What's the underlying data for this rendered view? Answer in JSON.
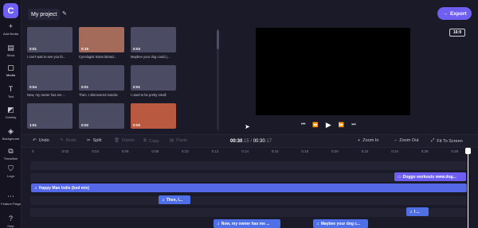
{
  "app": {
    "logo": "C"
  },
  "rail": [
    {
      "icon": "plus-icon",
      "glyph": "+",
      "label": "Add Media"
    },
    {
      "icon": "stock-icon",
      "glyph": "▤",
      "label": "Stock"
    },
    {
      "icon": "media-icon",
      "glyph": "▢",
      "label": "Media"
    },
    {
      "icon": "text-icon",
      "glyph": "T",
      "label": "Text"
    },
    {
      "icon": "overlay-icon",
      "glyph": "◩",
      "label": "Overlay"
    },
    {
      "icon": "background-icon",
      "glyph": "◈",
      "label": "Background"
    },
    {
      "icon": "transition-icon",
      "glyph": "⧉",
      "label": "Transition"
    },
    {
      "icon": "logo-icon",
      "glyph": "⛉",
      "label": "Logo"
    },
    {
      "icon": "feature-flags-icon",
      "glyph": "⋯",
      "label": "Feature Flags"
    },
    {
      "icon": "help-icon",
      "glyph": "?",
      "label": "Help"
    }
  ],
  "header": {
    "project_title": "My project",
    "edit_glyph": "✎",
    "export_label": "Export",
    "export_glyph": "→",
    "ratio": "16:9"
  },
  "media": [
    {
      "duration": "0:01",
      "caption": "I can't wait to see you th...",
      "color": "#4b4b64"
    },
    {
      "duration": "0:15",
      "caption": "Cynologist trains labrad...",
      "color": "#a46b5a"
    },
    {
      "duration": "0:03",
      "caption": "Maybee your dog could j...",
      "color": "#4b4b64"
    },
    {
      "duration": "0:04",
      "caption": "Now, my owner has me ...",
      "color": "#4b4b64"
    },
    {
      "duration": "0:01",
      "caption": "Then, I discovered snacks",
      "color": "#4b4b64"
    },
    {
      "duration": "0:01",
      "caption": "I used to be pretty small",
      "color": "#4b4b64"
    },
    {
      "duration": "1:51",
      "caption": "",
      "color": "#4b4b64"
    },
    {
      "duration": "0:02",
      "caption": "",
      "color": "#4b4b64"
    },
    {
      "duration": "0:00",
      "caption": "",
      "color": "#b9593f"
    }
  ],
  "transport": {
    "skip_back": "⏮",
    "rewind": "⏪",
    "play": "▶",
    "forward": "⏩",
    "skip_forward": "⏭"
  },
  "toolbar": {
    "undo": "Undo",
    "redo": "Redo",
    "split": "Split",
    "delete": "Delete",
    "copy": "Copy",
    "paste": "Paste",
    "time_current": "00:30",
    "time_current_frac": ".15",
    "time_sep": " / ",
    "time_total": "00:30",
    "time_total_frac": ".17",
    "zoom_in": "Zoom In",
    "zoom_out": "Zoom Out",
    "fit": "Fit To Screen"
  },
  "ruler": [
    "0",
    "0:02",
    "0:04",
    "0:06",
    "0:08",
    "0:10",
    "0:12",
    "0:14",
    "0:16",
    "0:18",
    "0:20",
    "0:22",
    "0:24",
    "0:26",
    "0:28",
    "0:30"
  ],
  "tracks": {
    "text_clip": "Doggo workouts www.dog...",
    "audio_clip": "Happy Man Indie (bed mix)",
    "clip_then": "Then, I...",
    "clip_i": "I ...",
    "clip_now": "Now, my owner has me ...",
    "clip_maybee": "Maybee your dog c..."
  }
}
